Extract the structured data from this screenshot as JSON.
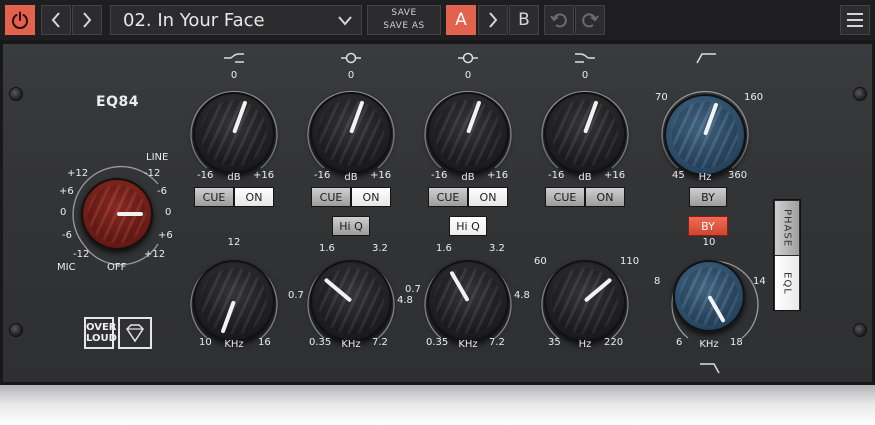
{
  "toolbar": {
    "preset_name": "02. In Your Face",
    "save_label": "SAVE",
    "save_as_label": "SAVE AS",
    "ab_a_label": "A",
    "ab_b_label": "B",
    "icons": [
      "power-icon",
      "chevron-left-icon",
      "chevron-right-icon",
      "chevron-down-icon",
      "arrow-right-icon",
      "undo-icon",
      "redo-icon",
      "hamburger-menu-icon"
    ],
    "accent_color": "#e2624e"
  },
  "device": {
    "name": "EQ84",
    "input": {
      "ticks": [
        "+12",
        "+6",
        "0",
        "-6",
        "-12"
      ],
      "line_label": "LINE",
      "line_ticks": [
        "-12",
        "-6",
        "0",
        "+6",
        "+12"
      ],
      "mic_label": "MIC",
      "off_label": "OFF"
    },
    "bands": [
      {
        "gain": {
          "top": "0",
          "min": "-16",
          "unit": "dB",
          "max": "+16"
        },
        "cue": "CUE",
        "on": "ON",
        "freq": {
          "top": "12",
          "min": "10",
          "unit": "KHz",
          "max": "16"
        }
      },
      {
        "gain": {
          "top": "0",
          "min": "-16",
          "unit": "dB",
          "max": "+16"
        },
        "cue": "CUE",
        "on": "ON",
        "hiq": "Hi Q",
        "freq": {
          "tl": "1.6",
          "tr": "3.2",
          "l": "0.7",
          "r": "4.8",
          "min": "0.35",
          "unit": "KHz",
          "max": "7.2"
        }
      },
      {
        "gain": {
          "top": "0",
          "min": "-16",
          "unit": "dB",
          "max": "+16"
        },
        "cue": "CUE",
        "on": "ON",
        "hiq": "Hi Q",
        "freq": {
          "tl": "1.6",
          "tr": "3.2",
          "l": "0.7",
          "r": "4.8",
          "min": "0.35",
          "unit": "KHz",
          "max": "7.2"
        }
      },
      {
        "gain": {
          "top": "0",
          "min": "-16",
          "unit": "dB",
          "max": "+16"
        },
        "cue": "CUE",
        "on": "ON",
        "freq": {
          "tl": "60",
          "tr": "110",
          "min": "35",
          "unit": "Hz",
          "max": "220"
        }
      }
    ],
    "hpf": {
      "tl": "70",
      "tr": "160",
      "min": "45",
      "unit": "Hz",
      "max": "360",
      "by": "BY"
    },
    "lpf": {
      "by": "BY",
      "top": "10",
      "l": "8",
      "r": "14",
      "min": "6",
      "unit": "KHz",
      "max": "18"
    },
    "phase_label": "PHASE",
    "eql_label": "EQL",
    "logo_text": "OVER LOUD"
  }
}
